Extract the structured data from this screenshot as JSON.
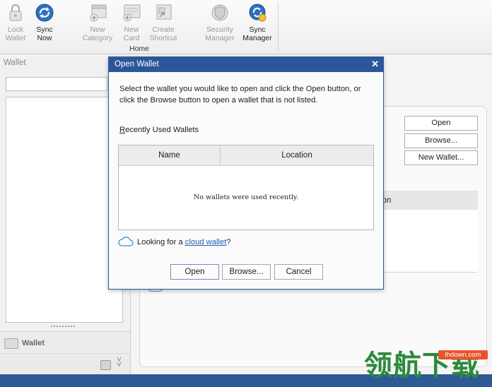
{
  "ribbon": {
    "buttons": [
      {
        "label1": "Lock",
        "label2": "Wallet",
        "disabled": true,
        "icon": "lock-icon"
      },
      {
        "label1": "Sync",
        "label2": "Now",
        "disabled": false,
        "icon": "sync-icon"
      },
      {
        "label1": "New",
        "label2": "Category",
        "disabled": true,
        "icon": "new-category-icon"
      },
      {
        "label1": "New",
        "label2": "Card",
        "disabled": true,
        "icon": "new-card-icon"
      },
      {
        "label1": "Create",
        "label2": "Shortcut",
        "disabled": true,
        "icon": "create-shortcut-icon"
      },
      {
        "label1": "Security",
        "label2": "Manager",
        "disabled": true,
        "icon": "security-manager-icon"
      },
      {
        "label1": "Sync",
        "label2": "Manager",
        "disabled": false,
        "icon": "sync-manager-icon"
      }
    ],
    "group_label": "Home"
  },
  "left_panel": {
    "title": "Wallet",
    "nav_label": "Wallet"
  },
  "main": {
    "buttons": {
      "open": "Open",
      "browse": "Browse...",
      "new_wallet": "New Wallet..."
    },
    "table_header_partial": "ion"
  },
  "dialog": {
    "title": "Open Wallet",
    "close": "✕",
    "instructions": "Select the wallet you would like to open and click the Open button, or click the Browse button to open a wallet that is not listed.",
    "recent_label_prefix": "R",
    "recent_label_rest": "ecently Used Wallets",
    "columns": {
      "name": "Name",
      "location": "Location"
    },
    "empty_message": "No wallets were used recently.",
    "cloud_prefix": "Looking for a ",
    "cloud_link": "cloud wallet",
    "cloud_suffix": "?",
    "buttons": {
      "open": "Open",
      "browse": "Browse...",
      "cancel": "Cancel"
    }
  },
  "watermark": {
    "host": "lhdown.com",
    "chinese": "领航下载"
  },
  "colors": {
    "titlebar": "#2b579a",
    "statusbar": "#2d5a95",
    "link": "#1f5fb4"
  }
}
